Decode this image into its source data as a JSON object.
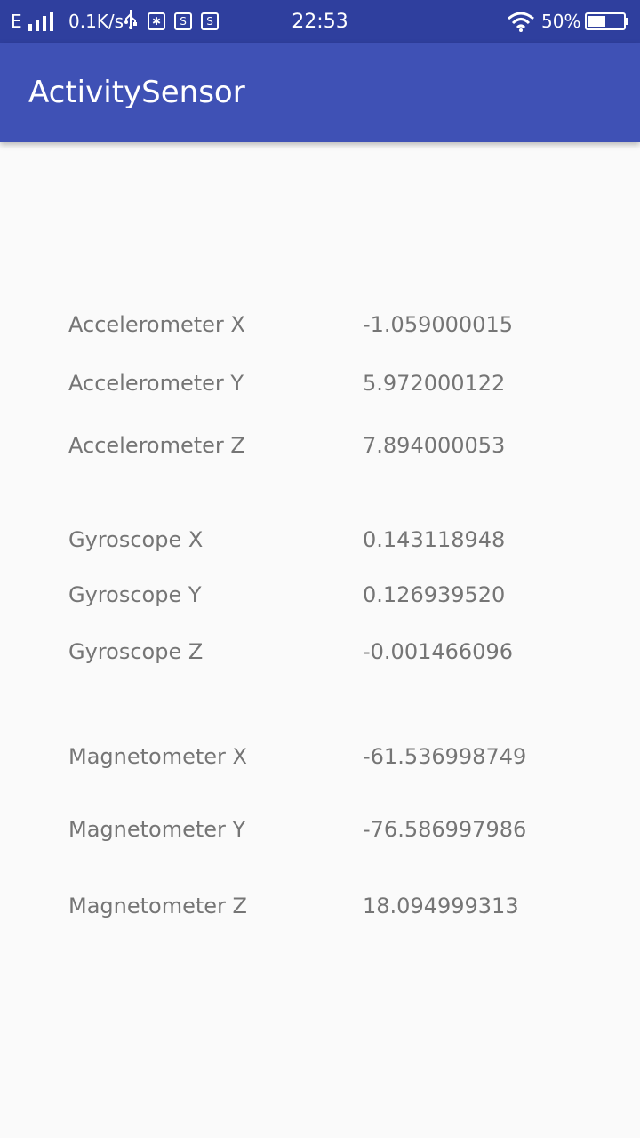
{
  "status_bar": {
    "network_type": "E",
    "speed": "0.1K/s",
    "time": "22:53",
    "battery_percent": "50%",
    "battery_level": 0.5,
    "icons": [
      "signal-icon",
      "usb-icon",
      "usb-debug-icon",
      "s-app-icon",
      "s-app-icon",
      "wifi-icon",
      "battery-charging-icon"
    ]
  },
  "app_bar": {
    "title": "ActivitySensor",
    "color": "#3f51b5"
  },
  "sensors": {
    "accelerometer": [
      {
        "label": "Accelerometer X",
        "value": "-1.059000015"
      },
      {
        "label": "Accelerometer Y",
        "value": "5.972000122"
      },
      {
        "label": "Accelerometer Z",
        "value": "7.894000053"
      }
    ],
    "gyroscope": [
      {
        "label": "Gyroscope X",
        "value": "0.143118948"
      },
      {
        "label": "Gyroscope Y",
        "value": "0.126939520"
      },
      {
        "label": "Gyroscope Z",
        "value": "-0.001466096"
      }
    ],
    "magnetometer": [
      {
        "label": "Magnetometer X",
        "value": "-61.536998749"
      },
      {
        "label": "Magnetometer Y",
        "value": "-76.586997986"
      },
      {
        "label": "Magnetometer Z",
        "value": "18.094999313"
      }
    ]
  }
}
